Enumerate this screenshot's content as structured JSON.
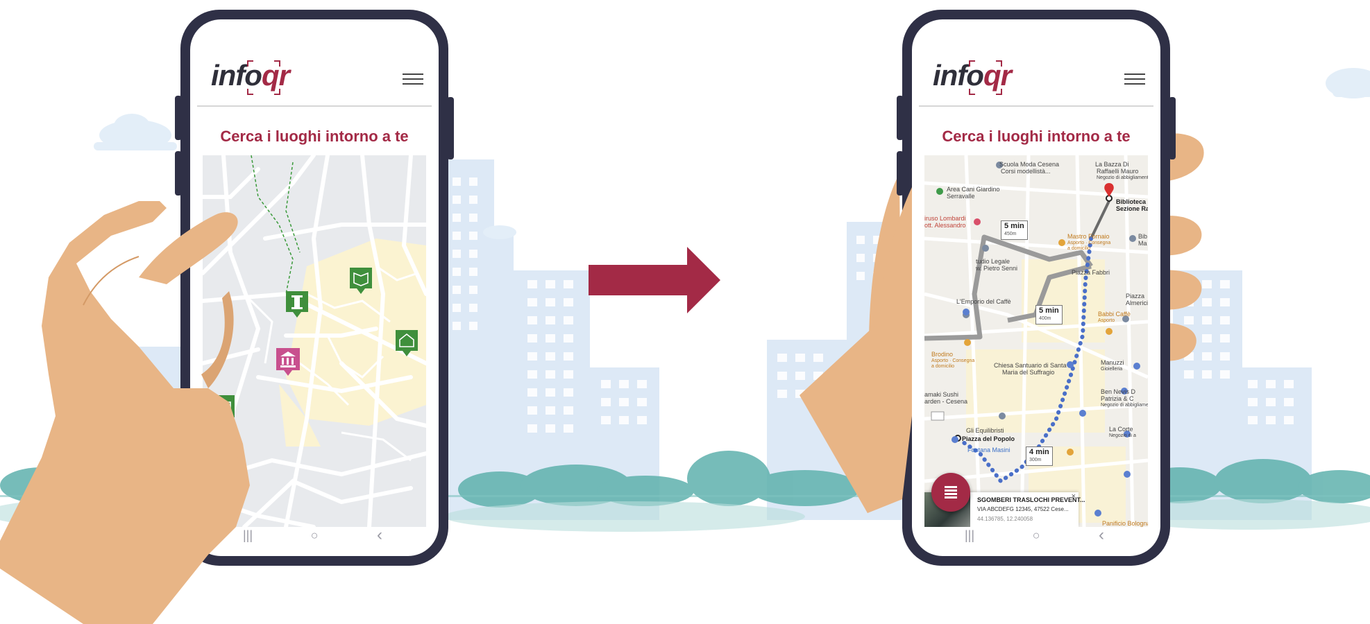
{
  "brand": {
    "logo_info": "info",
    "logo_qr": "qr"
  },
  "screen_title": "Cerca i luoghi intorno a te",
  "navbar": {
    "recents": "|||",
    "home": "○",
    "back": "‹"
  },
  "map_right": {
    "labels": [
      "Scuola Moda Cesena",
      "Corsi modellistà...",
      "La Bazza Di",
      "Raffaelli Mauro",
      "Negozio di abbigliamento",
      "Area Cani Giardino",
      "Serravalle",
      "Biblioteca M",
      "Sezione Rag",
      "iruso Lombardi",
      "ott. Alessandro",
      "Mastro Fornaio",
      "Asporto · Consegna",
      "a domicilio",
      "Bib",
      "Ma",
      "tudio Legale",
      "w. Pietro Senni",
      "Piazza Fabbri",
      "L'Emporio del Caffè",
      "Piazza",
      "Almerici",
      "Babbi Caffè",
      "Asporto",
      "Brodino",
      "Asporto · Consegna",
      "a domicilio",
      "Chiesa Santuario di Santa",
      "Maria del Suffragio",
      "Manuzzi",
      "Gioielleria",
      "amaki Sushi",
      "arden - Cesena",
      "Ben Nevis D",
      "Patrizia & C",
      "Negozio di abbigliamento",
      "Gli Equilibristi",
      "Piazza del Popolo",
      "Fontana Masini",
      "La Corte",
      "Negozio di a",
      "Panificio Bologna"
    ],
    "times": [
      {
        "time": "5 min",
        "dist": "450m"
      },
      {
        "time": "5 min",
        "dist": "400m"
      },
      {
        "time": "4 min",
        "dist": "300m"
      }
    ]
  },
  "place_card": {
    "name": "SGOMBERI TRASLOCHI PREVENT...",
    "address": "VIA ABCDEFG 12345, 47522 Cese...",
    "coords": "44.136785, 12.240058",
    "close": "×"
  },
  "colors": {
    "brand": "#a32a46",
    "phone": "#2f3046",
    "skin": "#e8b586",
    "route_dots": "#4a6fc8",
    "marker_green": "#3f8f3c",
    "marker_pink": "#c8508e"
  }
}
